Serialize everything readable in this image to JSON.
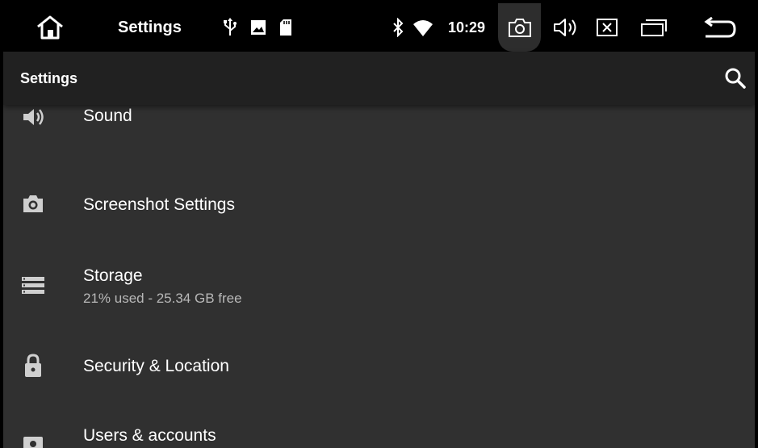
{
  "statusbar": {
    "home_icon": "home-icon",
    "title": "Settings",
    "indicators": [
      "usb-icon",
      "image-icon",
      "sd-card-icon",
      "bluetooth-icon",
      "wifi-icon"
    ],
    "time": "10:29",
    "buttons": [
      "screenshot-icon",
      "volume-icon",
      "close-app-icon",
      "recents-icon",
      "back-icon"
    ]
  },
  "toolbar": {
    "title": "Settings",
    "search_icon": "search-icon"
  },
  "settings_list": [
    {
      "icon": "volume-icon",
      "title": "Sound",
      "subtitle": ""
    },
    {
      "icon": "camera-icon",
      "title": "Screenshot Settings",
      "subtitle": ""
    },
    {
      "icon": "storage-icon",
      "title": "Storage",
      "subtitle": "21% used - 25.34 GB free"
    },
    {
      "icon": "lock-icon",
      "title": "Security & Location",
      "subtitle": ""
    },
    {
      "icon": "account-icon",
      "title": "Users & accounts",
      "subtitle": ""
    }
  ],
  "colors": {
    "background": "#303030",
    "toolbar": "#212121",
    "statusbar": "#000000",
    "text_primary": "#ffffff",
    "text_secondary": "#b8b8b8",
    "icon": "#cfcfcf"
  }
}
